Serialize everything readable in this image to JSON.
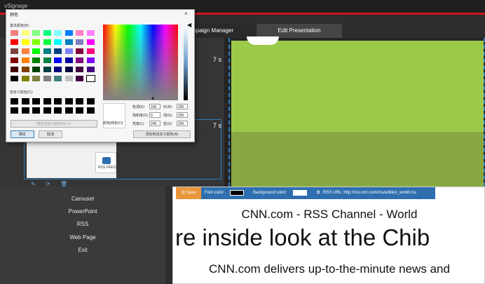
{
  "window": {
    "title": "vSignage"
  },
  "tabs": [
    {
      "label": "mpaign Manager"
    },
    {
      "label": "Edit Presentation"
    }
  ],
  "durations": [
    "7 s",
    "7 s"
  ],
  "type_menu": [
    "Carousel",
    "PowerPoint",
    "RSS",
    "Web Page",
    "Exit"
  ],
  "rss_toolbar": {
    "save_label": "Save",
    "font_color_label": "Font color:",
    "font_color": "#000000",
    "background_color_label": "Background color:",
    "background_color": "#ffffff",
    "rss_url_label": "RSS URL: http://rss.cnn.com/rss/edition_world.rss"
  },
  "rss_content": {
    "channel_title": "CNN.com - RSS Channel - World",
    "headline": "re inside look at the Chib",
    "description": "CNN.com delivers up-to-the-minute news and"
  },
  "color_dialog": {
    "title": "颜色",
    "basic_colors_label": "基本颜色(B):",
    "custom_colors_label": "自定义颜色(C):",
    "define_custom_button": "规定自定义颜色(D) >>",
    "ok_button": "确定",
    "cancel_button": "取消",
    "color_solid_label": "颜色|纯色(O)",
    "add_custom_button": "添加到自定义颜色(A)",
    "fields": {
      "hue_label": "色调(E):",
      "hue": "160",
      "sat_label": "饱和度(S):",
      "sat": "0",
      "lum_label": "亮度(L):",
      "lum": "240",
      "red_label": "红(R):",
      "red": "255",
      "green_label": "绿(G):",
      "green": "255",
      "blue_label": "蓝(U):",
      "blue": "255"
    },
    "basic_colors": [
      "#f08080",
      "#ffff80",
      "#80ff80",
      "#00ff80",
      "#80ffff",
      "#0080ff",
      "#ff80c0",
      "#ff80ff",
      "#ff0000",
      "#ffff00",
      "#80ff00",
      "#00ff40",
      "#00ffff",
      "#0080c0",
      "#8080c0",
      "#ff00ff",
      "#804040",
      "#ff8040",
      "#00ff00",
      "#008080",
      "#004080",
      "#8080ff",
      "#800040",
      "#ff0080",
      "#800000",
      "#ff8000",
      "#008000",
      "#008040",
      "#0000ff",
      "#0000a0",
      "#800080",
      "#8000ff",
      "#400000",
      "#804000",
      "#004000",
      "#004040",
      "#000080",
      "#000040",
      "#400040",
      "#400080",
      "#000000",
      "#808000",
      "#808040",
      "#808080",
      "#408080",
      "#c0c0c0",
      "#400040",
      "#ffffff"
    ]
  }
}
